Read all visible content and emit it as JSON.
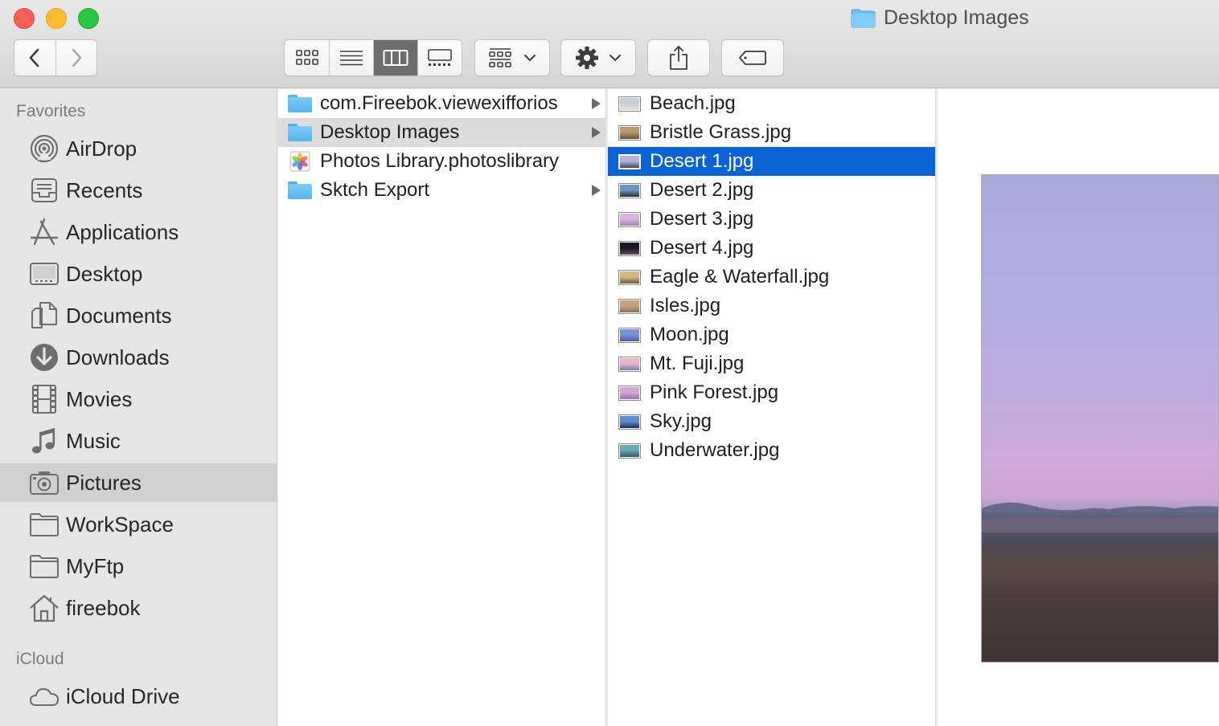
{
  "window": {
    "title": "Desktop Images"
  },
  "toolbar": {
    "back": "chevron-left-icon",
    "forward": "chevron-right-icon",
    "views": [
      "icon-view-icon",
      "list-view-icon",
      "column-view-icon",
      "gallery-view-icon"
    ],
    "active_view": "column-view-icon",
    "group": "group-icon",
    "action": "gear-icon",
    "share": "share-icon",
    "tags": "tag-icon"
  },
  "sidebar": {
    "favorites_heading": "Favorites",
    "favorites": [
      {
        "label": "AirDrop",
        "icon": "airdrop-icon"
      },
      {
        "label": "Recents",
        "icon": "recents-icon"
      },
      {
        "label": "Applications",
        "icon": "applications-icon"
      },
      {
        "label": "Desktop",
        "icon": "desktop-icon"
      },
      {
        "label": "Documents",
        "icon": "documents-icon"
      },
      {
        "label": "Downloads",
        "icon": "downloads-icon"
      },
      {
        "label": "Movies",
        "icon": "movies-icon"
      },
      {
        "label": "Music",
        "icon": "music-icon"
      },
      {
        "label": "Pictures",
        "icon": "pictures-icon",
        "selected": true
      },
      {
        "label": "WorkSpace",
        "icon": "folder-icon"
      },
      {
        "label": "MyFtp",
        "icon": "folder-icon"
      },
      {
        "label": "fireebok",
        "icon": "home-icon"
      }
    ],
    "icloud_heading": "iCloud",
    "icloud": [
      {
        "label": "iCloud Drive",
        "icon": "cloud-icon"
      }
    ]
  },
  "column1": {
    "items": [
      {
        "label": "com.Fireebok.viewexifforios",
        "type": "folder",
        "has_children": true
      },
      {
        "label": "Desktop Images",
        "type": "folder",
        "has_children": true,
        "selected": true
      },
      {
        "label": "Photos Library.photoslibrary",
        "type": "photoslibrary",
        "has_children": false
      },
      {
        "label": "Sktch Export",
        "type": "folder",
        "has_children": true
      }
    ]
  },
  "column2": {
    "items": [
      {
        "label": "Beach.jpg",
        "thumb": [
          "#c7ced4",
          "#e7e3dc"
        ]
      },
      {
        "label": "Bristle Grass.jpg",
        "thumb": [
          "#b99a6c",
          "#6b4f33"
        ]
      },
      {
        "label": "Desert 1.jpg",
        "thumb": [
          "#b7b1df",
          "#4b4350"
        ],
        "selected": true
      },
      {
        "label": "Desert 2.jpg",
        "thumb": [
          "#6d93c1",
          "#2d2c36"
        ]
      },
      {
        "label": "Desert 3.jpg",
        "thumb": [
          "#d8b8dc",
          "#a77eb3"
        ]
      },
      {
        "label": "Desert 4.jpg",
        "thumb": [
          "#1a1626",
          "#6a4553"
        ]
      },
      {
        "label": "Eagle & Waterfall.jpg",
        "thumb": [
          "#d8b680",
          "#6b5a3a"
        ]
      },
      {
        "label": "Isles.jpg",
        "thumb": [
          "#c6a27a",
          "#8a6f55"
        ]
      },
      {
        "label": "Moon.jpg",
        "thumb": [
          "#7d8fd3",
          "#4d5fa8"
        ]
      },
      {
        "label": "Mt. Fuji.jpg",
        "thumb": [
          "#e8b7c7",
          "#6e7fb0"
        ]
      },
      {
        "label": "Pink Forest.jpg",
        "thumb": [
          "#d6a6d6",
          "#9e6fb2"
        ]
      },
      {
        "label": "Sky.jpg",
        "thumb": [
          "#5e8fd0",
          "#1e2d55"
        ]
      },
      {
        "label": "Underwater.jpg",
        "thumb": [
          "#6aa9b3",
          "#2d5b6b"
        ]
      }
    ]
  },
  "preview": {
    "file": "Desert 1.jpg"
  }
}
